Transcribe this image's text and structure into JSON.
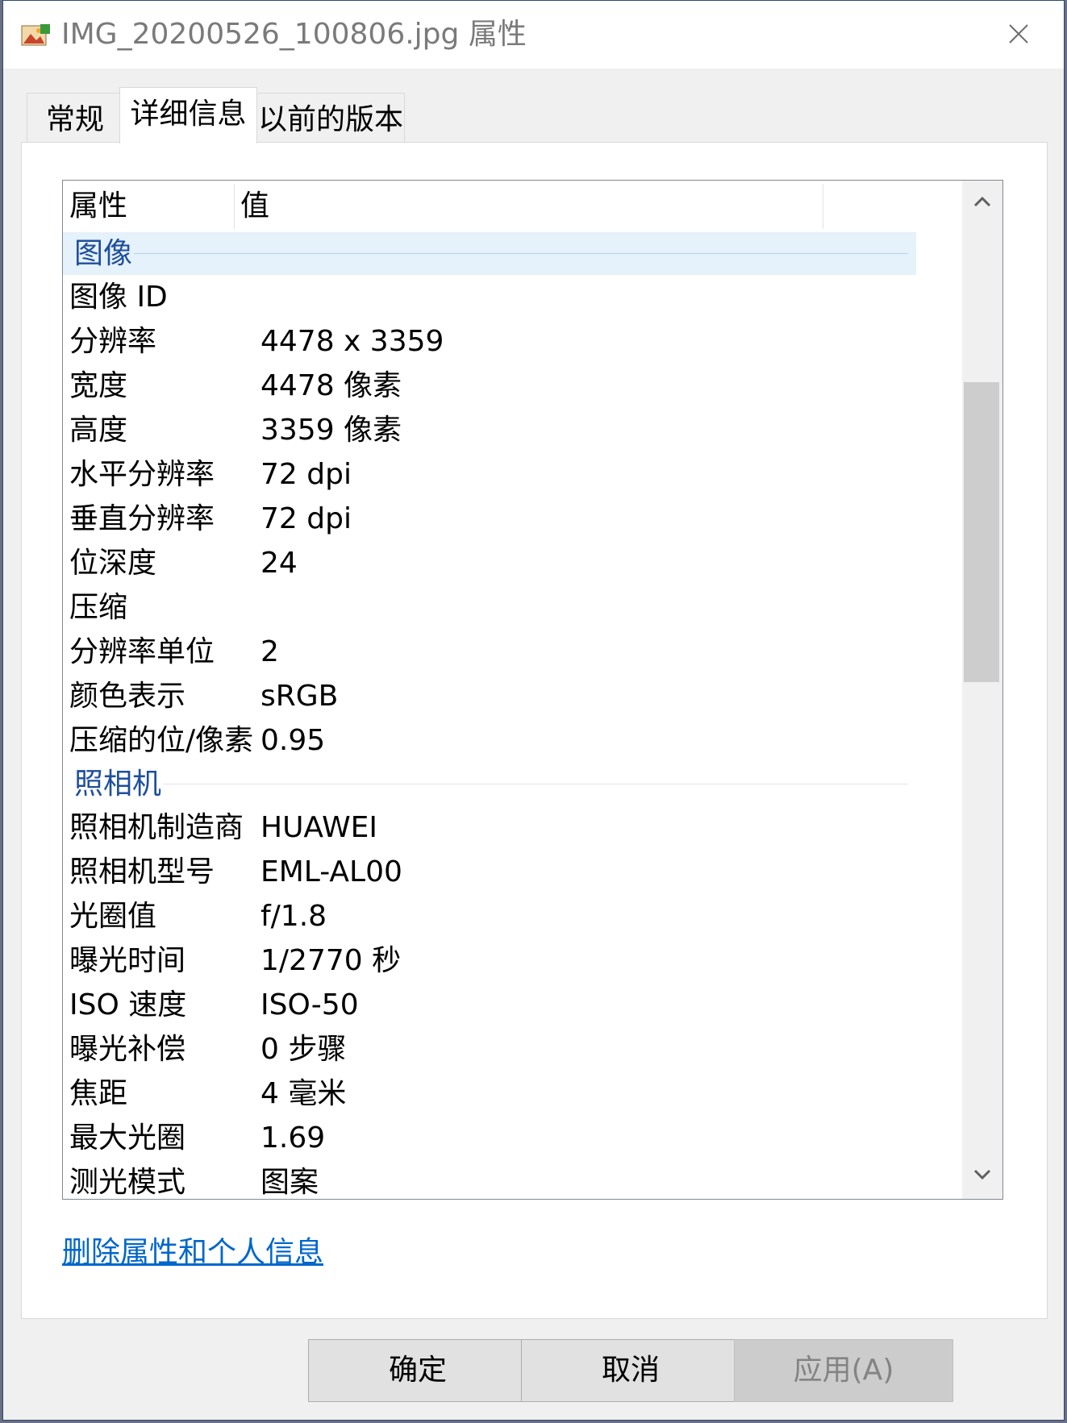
{
  "window": {
    "title": "IMG_20200526_100806.jpg 属性",
    "icon": "photo-file-icon",
    "close_icon": "close-icon"
  },
  "tabs": [
    {
      "label": "常规",
      "active": false
    },
    {
      "label": "详细信息",
      "active": true
    },
    {
      "label": "以前的版本",
      "active": false
    }
  ],
  "list": {
    "headers": {
      "property": "属性",
      "value": "值"
    },
    "groups": {
      "image": {
        "label": "图像",
        "rows": [
          {
            "k": "图像 ID",
            "v": ""
          },
          {
            "k": "分辨率",
            "v": "4478 x 3359"
          },
          {
            "k": "宽度",
            "v": "4478 像素"
          },
          {
            "k": "高度",
            "v": "3359 像素"
          },
          {
            "k": "水平分辨率",
            "v": "72 dpi"
          },
          {
            "k": "垂直分辨率",
            "v": "72 dpi"
          },
          {
            "k": "位深度",
            "v": "24"
          },
          {
            "k": "压缩",
            "v": ""
          },
          {
            "k": "分辨率单位",
            "v": "2"
          },
          {
            "k": "颜色表示",
            "v": "sRGB"
          },
          {
            "k": "压缩的位/像素",
            "v": "0.95"
          }
        ]
      },
      "camera": {
        "label": "照相机",
        "rows": [
          {
            "k": "照相机制造商",
            "v": "HUAWEI"
          },
          {
            "k": "照相机型号",
            "v": "EML-AL00"
          },
          {
            "k": "光圈值",
            "v": "f/1.8"
          },
          {
            "k": "曝光时间",
            "v": "1/2770 秒"
          },
          {
            "k": "ISO 速度",
            "v": "ISO-50"
          },
          {
            "k": "曝光补偿",
            "v": "0 步骤"
          },
          {
            "k": "焦距",
            "v": "4 毫米"
          },
          {
            "k": "最大光圈",
            "v": "1.69"
          },
          {
            "k": "测光模式",
            "v": "图案"
          }
        ]
      }
    },
    "scrollbar": {
      "up_icon": "chevron-up-icon",
      "down_icon": "chevron-down-icon"
    }
  },
  "remove_link": "删除属性和个人信息",
  "buttons": {
    "ok": "确定",
    "cancel": "取消",
    "apply": "应用(A)"
  },
  "colors": {
    "group_label": "#1e4f9c",
    "link": "#0066cc",
    "selected_row": "#e5f1fb"
  }
}
